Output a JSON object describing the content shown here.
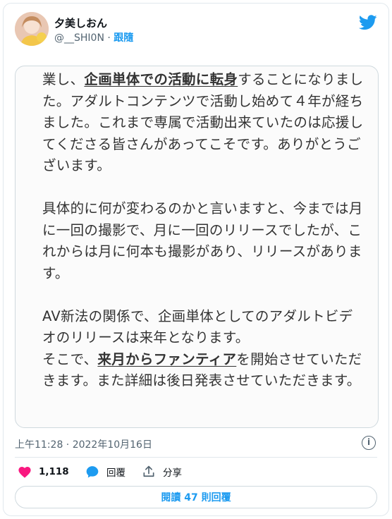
{
  "author": {
    "name": "夕美しおん",
    "handle": "@__SHI0N",
    "separator": "·",
    "follow_label": "跟隨"
  },
  "tweet_image": {
    "paragraph1_pre": "業し、",
    "paragraph1_u": "企画単体での活動に転身",
    "paragraph1_post": "することになりました。アダルトコンテンツで活動し始めて４年が経ちました。これまで専属で活動出来ていたのは応援してくださる皆さんがあってこそです。ありがとうございます。",
    "paragraph2": "具体的に何が変わるのかと言いますと、今までは月に一回の撮影で、月に一回のリリースでしたが、これからは月に何本も撮影があり、リリースがあります。",
    "paragraph3_line1": "AV新法の関係で、企画単体としてのアダルトビデオのリリースは来年となります。",
    "paragraph3_pre": "そこで、",
    "paragraph3_u": "来月からファンティア",
    "paragraph3_post": "を開始させていただきます。また詳細は後日発表させていただきます。"
  },
  "timestamp": "上午11:28 · 2022年10月16日",
  "actions": {
    "likes": "1,118",
    "reply_label": "回覆",
    "share_label": "分享"
  },
  "read_replies_label": "閱讀 47 則回覆",
  "colors": {
    "accent": "#1d9bf0",
    "heart": "#f91880",
    "muted": "#536471"
  },
  "icons": [
    "twitter-bird-icon",
    "info-icon",
    "heart-icon",
    "reply-bubble-icon",
    "share-icon"
  ]
}
